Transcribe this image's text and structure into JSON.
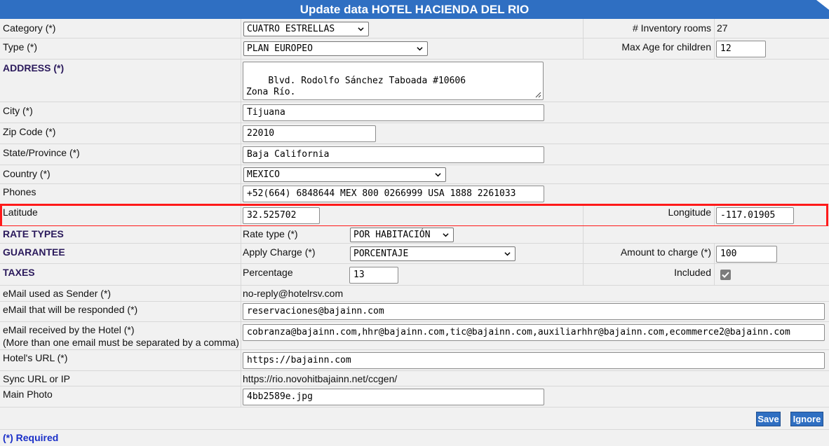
{
  "title": "Update data HOTEL HACIENDA DEL RIO",
  "category": {
    "label": "Category (*)",
    "value": "CUATRO ESTRELLAS"
  },
  "inventory": {
    "label": "# Inventory rooms",
    "value": "27"
  },
  "type": {
    "label": "Type (*)",
    "value": "PLAN EUROPEO"
  },
  "max_age": {
    "label": "Max Age for children",
    "value": "12"
  },
  "address": {
    "label": "ADDRESS (*)",
    "value": "Blvd. Rodolfo Sánchez Taboada #10606\nZona Río."
  },
  "city": {
    "label": "City (*)",
    "value": "Tijuana"
  },
  "zip": {
    "label": "Zip Code (*)",
    "value": "22010"
  },
  "state": {
    "label": "State/Province (*)",
    "value": "Baja California"
  },
  "country": {
    "label": "Country (*)",
    "value": "MEXICO"
  },
  "phones": {
    "label": "Phones",
    "value": "+52(664) 6848644 MEX 800 0266999 USA 1888 2261033"
  },
  "latitude": {
    "label": "Latitude",
    "value": "32.525702"
  },
  "longitude": {
    "label": "Longitude",
    "value": "-117.01905"
  },
  "rate_types": {
    "label": "RATE TYPES",
    "sub_label": "Rate type (*)",
    "value": "POR HABITACIÓN"
  },
  "guarantee": {
    "label": "GUARANTEE",
    "sub_label": "Apply Charge (*)",
    "value": "PORCENTAJE",
    "amount_label": "Amount to charge (*)",
    "amount_value": "100"
  },
  "taxes": {
    "label": "TAXES",
    "sub_label": "Percentage",
    "value": "13",
    "included_label": "Included",
    "included_checked": true
  },
  "email_sender": {
    "label": "eMail used as Sender (*)",
    "value": "no-reply@hotelrsv.com"
  },
  "email_responded": {
    "label": "eMail that will be responded (*)",
    "value": "reservaciones@bajainn.com"
  },
  "email_received": {
    "label": "eMail received by the Hotel (*)",
    "note": "(More than one email must be separated by a comma)",
    "value": "cobranza@bajainn.com,hhr@bajainn.com,tic@bajainn.com,auxiliarhhr@bajainn.com,ecommerce2@bajainn.com"
  },
  "hotel_url": {
    "label": "Hotel's URL (*)",
    "value": "https://bajainn.com"
  },
  "sync_url": {
    "label": "Sync URL or IP",
    "value": "https://rio.novohitbajainn.net/ccgen/"
  },
  "main_photo": {
    "label": "Main Photo",
    "value": "4bb2589e.jpg"
  },
  "buttons": {
    "save": "Save",
    "ignore": "Ignore"
  },
  "required_note": "(*) Required",
  "colors": {
    "header": "#2f6fc2",
    "highlight": "#ff1a1a",
    "section_label": "#2b1a5c",
    "required": "#1a2fc8"
  },
  "icons": [
    "chevron-down-icon",
    "resize-grip-icon",
    "checkbox-checked-icon"
  ]
}
